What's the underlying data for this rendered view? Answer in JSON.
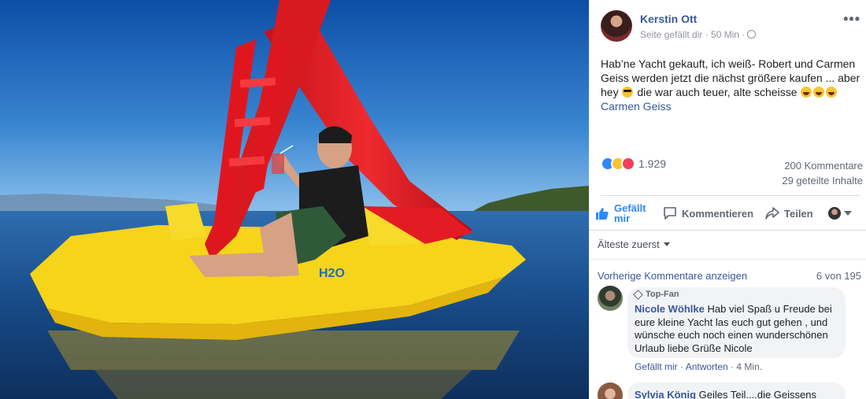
{
  "post": {
    "author": "Kerstin Ott",
    "meta": "Seite gefällt dir · 50 Min ·",
    "more": "•••",
    "text_before": "Hab’ne Yacht gekauft, ich weiß- Robert und Carmen Geiss werden jetzt die nächst größere kaufen ... aber hey ",
    "text_middle": " die war auch teuer, alte scheisse ",
    "tag": "Carmen Geiss"
  },
  "stats": {
    "reactions": "1.929",
    "comments": "200 Kommentare",
    "shares": "29 geteilte Inhalte"
  },
  "actions": {
    "like_line1": "Gefällt",
    "like_line2": "mir",
    "comment": "Kommentieren",
    "share": "Teilen"
  },
  "comments_section": {
    "sort": "Älteste zuerst",
    "previous": "Vorherige Kommentare anzeigen",
    "count": "6 von 195",
    "items": [
      {
        "badge": "Top-Fan",
        "name": "Nicole Wöhlke",
        "text": "Hab viel Spaß u Freude bei eure kleine Yacht las euch gut gehen , und wünsche euch noch einen wunderschönen Urlaub liebe Grüße Nicole",
        "like": "Gefällt mir",
        "reply": "Antworten",
        "time": "4 Min."
      },
      {
        "name": "Sylvia König",
        "text": "Geiles Teil....die Geissens"
      }
    ]
  },
  "photo": {
    "boat_label": "H2O"
  },
  "colors": {
    "link": "#385898",
    "like_blue": "#2d88ff",
    "sea": "#1d4f8a",
    "sky": "#1f6bc4",
    "boat_yellow": "#f6d41a",
    "slide_red": "#e51e25"
  }
}
